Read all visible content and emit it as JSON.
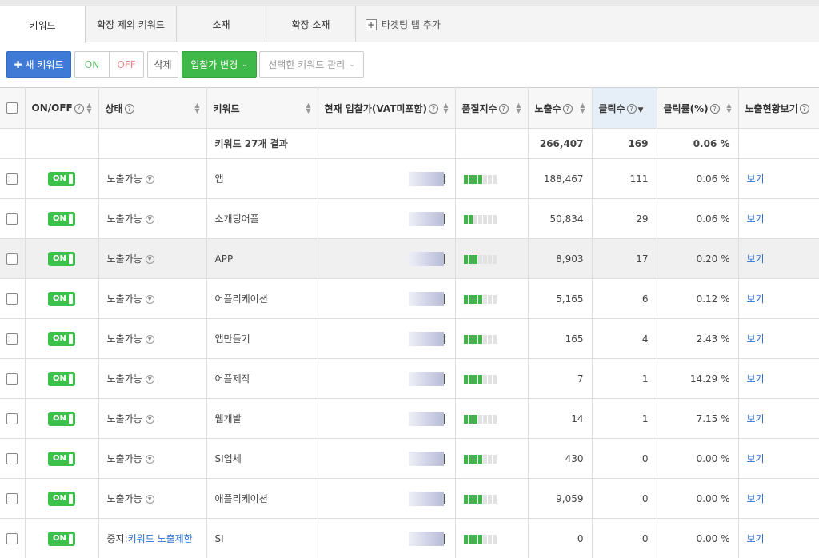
{
  "tabs": [
    {
      "label": "키워드",
      "active": true
    },
    {
      "label": "확장 제외 키워드",
      "active": false
    },
    {
      "label": "소재",
      "active": false
    },
    {
      "label": "확장 소재",
      "active": false
    }
  ],
  "add_tab_label": "타겟팅 탭 추가",
  "toolbar": {
    "new_keyword": "새 키워드",
    "on": "ON",
    "off": "OFF",
    "delete": "삭제",
    "bid_change": "입찰가 변경",
    "manage_selected": "선택한 키워드 관리"
  },
  "columns": {
    "onoff": "ON/OFF",
    "status": "상태",
    "keyword": "키워드",
    "bid": "현재 입찰가(VAT미포함)",
    "quality": "품질지수",
    "impressions": "노출수",
    "clicks": "클릭수",
    "ctr": "클릭률(%)",
    "view": "노출현황보기"
  },
  "summary": {
    "keyword": "키워드 27개 결과",
    "impressions": "266,407",
    "clicks": "169",
    "ctr": "0.06 %"
  },
  "rows": [
    {
      "toggle": "ON",
      "status": "노출가능",
      "keyword": "앱",
      "quality": 4,
      "impressions": "188,467",
      "clicks": "111",
      "ctr": "0.06 %",
      "view": "보기"
    },
    {
      "toggle": "ON",
      "status": "노출가능",
      "keyword": "소개팅어플",
      "quality": 2,
      "impressions": "50,834",
      "clicks": "29",
      "ctr": "0.06 %",
      "view": "보기"
    },
    {
      "toggle": "ON",
      "status": "노출가능",
      "keyword": "APP",
      "quality": 3,
      "impressions": "8,903",
      "clicks": "17",
      "ctr": "0.20 %",
      "view": "보기"
    },
    {
      "toggle": "ON",
      "status": "노출가능",
      "keyword": "어플리케이션",
      "quality": 4,
      "impressions": "5,165",
      "clicks": "6",
      "ctr": "0.12 %",
      "view": "보기"
    },
    {
      "toggle": "ON",
      "status": "노출가능",
      "keyword": "앱만들기",
      "quality": 4,
      "impressions": "165",
      "clicks": "4",
      "ctr": "2.43 %",
      "view": "보기"
    },
    {
      "toggle": "ON",
      "status": "노출가능",
      "keyword": "어플제작",
      "quality": 4,
      "impressions": "7",
      "clicks": "1",
      "ctr": "14.29 %",
      "view": "보기"
    },
    {
      "toggle": "ON",
      "status": "노출가능",
      "keyword": "웹개발",
      "quality": 3,
      "impressions": "14",
      "clicks": "1",
      "ctr": "7.15 %",
      "view": "보기"
    },
    {
      "toggle": "ON",
      "status": "노출가능",
      "keyword": "SI업체",
      "quality": 4,
      "impressions": "430",
      "clicks": "0",
      "ctr": "0.00 %",
      "view": "보기"
    },
    {
      "toggle": "ON",
      "status": "노출가능",
      "keyword": "애플리케이션",
      "quality": 4,
      "impressions": "9,059",
      "clicks": "0",
      "ctr": "0.00 %",
      "view": "보기"
    },
    {
      "toggle": "ON",
      "status_prefix": "중지:",
      "status_link": "키워드 노출제한",
      "keyword": "SI",
      "quality": 4,
      "impressions": "0",
      "clicks": "0",
      "ctr": "0.00 %",
      "view": "보기"
    }
  ]
}
